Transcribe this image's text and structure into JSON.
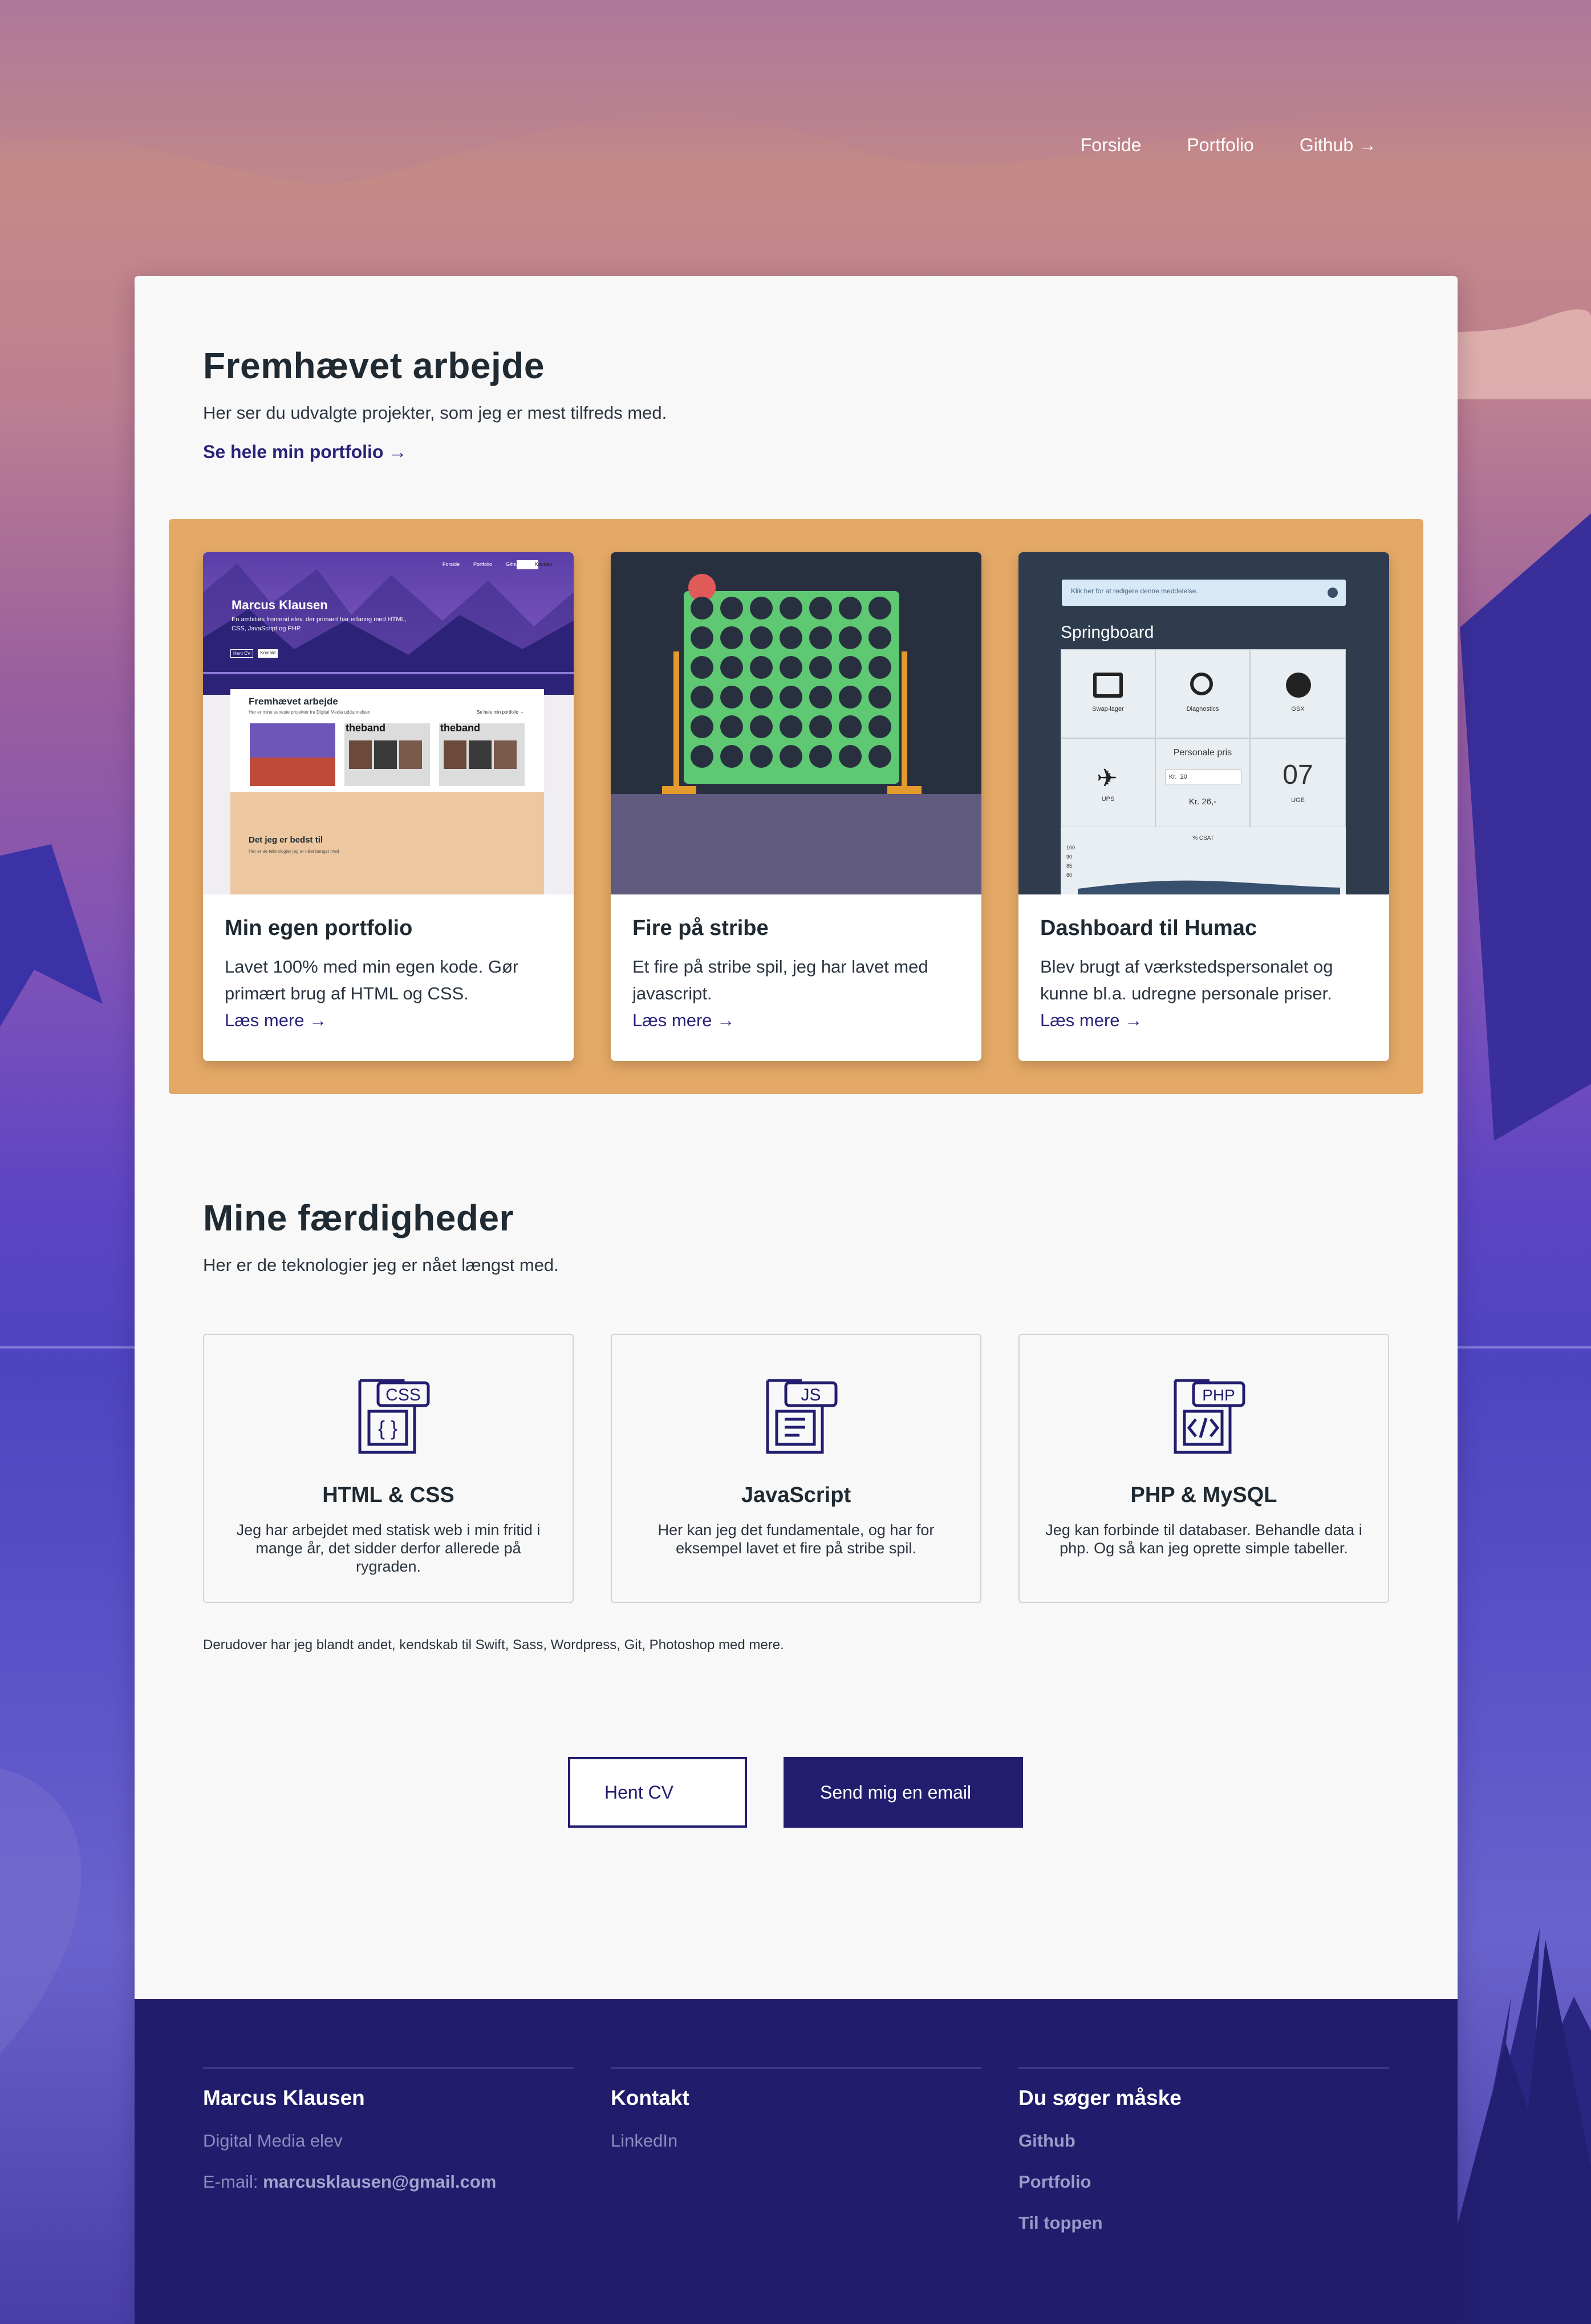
{
  "nav": {
    "items": [
      "Forside",
      "Portfolio",
      "Github →"
    ]
  },
  "featured": {
    "title": "Fremhævet arbejde",
    "lead": "Her ser du udvalgte projekter, som jeg er mest tilfreds med.",
    "link": "Se hele min portfolio →",
    "projects": [
      {
        "title": "Min egen portfolio",
        "desc": "Lavet 100% med min egen kode. Gør primært brug af HTML og CSS.",
        "link": "Læs mere →"
      },
      {
        "title": "Fire på stribe",
        "desc": "Et fire på stribe spil, jeg har lavet med javascript.",
        "link": "Læs mere →"
      },
      {
        "title": "Dashboard til Humac",
        "desc": "Blev brugt af værkstedspersonalet og kunne bl.a. udregne personale priser.",
        "link": "Læs mere →"
      }
    ]
  },
  "thumb1": {
    "name": "Marcus Klausen",
    "sub1": "En ambitiøs frontend elev, der primært har erfaring med HTML,",
    "sub2": "CSS, JavaScript og PHP.",
    "nav": [
      "Forside",
      "Portfolio",
      "Github",
      "Kontakt"
    ],
    "featured": "Fremhævet arbejde",
    "featured_sub": "Her er mine seneste projekter fra Digital Media uddannelsen",
    "featured_link": "Se hele min portfolio →",
    "band": "theband",
    "skills": "Det jeg er bedst til",
    "skills_sub": "Her er de teknologier jeg er nået længst med",
    "btn1": "Hent CV",
    "btn2": "Kontakt"
  },
  "thumb3": {
    "notice": "Klik her for at redigere denne meddelelse.",
    "title": "Springboard",
    "tiles": [
      "Swap-lager",
      "Diagnostics",
      "GSX",
      "UPS"
    ],
    "price_label": "Personale pris",
    "price_kr1": "Kr.",
    "price_input": "20",
    "price_result": "Kr. 26,-",
    "week_num": "07",
    "week_label": "UGE",
    "chart_label": "% CSAT",
    "chart_ticks": [
      "100",
      "90",
      "85",
      "80"
    ]
  },
  "skills": {
    "title": "Mine færdigheder",
    "lead": "Her er de teknologier jeg er nået længst med.",
    "items": [
      {
        "icon_tag": "CSS",
        "title": "HTML & CSS",
        "desc": "Jeg har arbejdet med statisk web i min fritid i mange år, det sidder derfor allerede på rygraden."
      },
      {
        "icon_tag": "JS",
        "title": "JavaScript",
        "desc": "Her kan jeg det fundamentale, og har for eksempel lavet et fire på stribe spil."
      },
      {
        "icon_tag": "PHP",
        "title": "PHP & MySQL",
        "desc": "Jeg kan forbinde til databaser. Behandle data i php. Og så kan jeg oprette simple tabeller."
      }
    ],
    "extra": "Derudover har jeg blandt andet, kendskab til Swift, Sass, Wordpress, Git, Photoshop med mere."
  },
  "cta": {
    "cv": "Hent CV",
    "mail": "Send mig en email"
  },
  "footer": {
    "col1": {
      "title": "Marcus Klausen",
      "role": "Digital Media elev",
      "email_label": "E-mail:",
      "email": "marcusklausen@gmail.com"
    },
    "col2": {
      "title": "Kontakt",
      "links": [
        "LinkedIn"
      ]
    },
    "col3": {
      "title": "Du søger måske",
      "links": [
        "Github",
        "Portfolio",
        "Til toppen"
      ]
    }
  },
  "colors": {
    "accent": "#211c6b",
    "band": "#e3a866",
    "link": "#2a237a"
  }
}
